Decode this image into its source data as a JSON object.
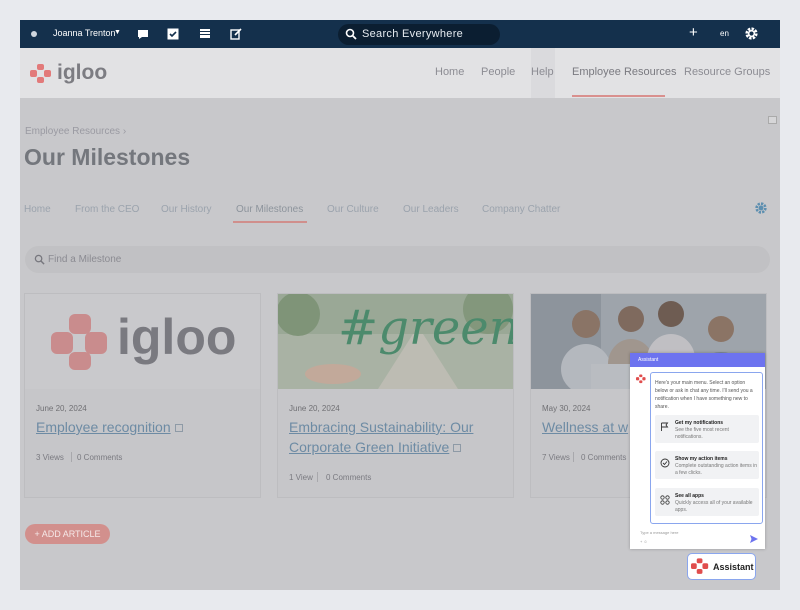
{
  "topbar": {
    "user_name": "Joanna Trenton",
    "search_placeholder": "Search Everywhere",
    "plus": "+",
    "language": "en"
  },
  "site": {
    "logo_text": "igloo",
    "nav": [
      "Home",
      "People",
      "Help",
      "Employee Resources",
      "Resource Groups"
    ],
    "active_nav": "Employee Resources"
  },
  "page": {
    "breadcrumb": "Employee Resources ›",
    "title": "Our Milestones",
    "subnav": [
      "Home",
      "From the CEO",
      "Our History",
      "Our Milestones",
      "Our Culture",
      "Our Leaders",
      "Company Chatter"
    ],
    "active_subnav": "Our Milestones",
    "search_placeholder": "Find a Milestone",
    "add_article": "+ ADD ARTICLE"
  },
  "cards": [
    {
      "date": "June 20, 2024",
      "title": "Employee recognition",
      "views": "3 Views",
      "comments": "0 Comments",
      "image": "igloo logo",
      "image_text": "igloo"
    },
    {
      "date": "June 20, 2024",
      "title": "Embracing Sustainability: Our Corporate Green Initiative",
      "views": "1 View",
      "comments": "0 Comments",
      "image": "#green hand photo",
      "image_text": "#green"
    },
    {
      "date": "May 30, 2024",
      "title": "Wellness at w",
      "views": "7 Views",
      "comments": "0 Comments",
      "image": "team photo"
    }
  ],
  "assistant": {
    "header": "Assistant",
    "intro": "Here's your main menu. Select an option below or ask in chat any time. I'll send you a notification when I have something new to share.",
    "options": [
      {
        "title": "Get my notifications",
        "desc": "See the five most recent notifications.",
        "icon": "flag-icon"
      },
      {
        "title": "Show my action items",
        "desc": "Complete outstanding action items in a few clicks.",
        "icon": "check-circle-icon"
      },
      {
        "title": "See all apps",
        "desc": "Quickly access all of your available apps.",
        "icon": "apps-icon"
      }
    ],
    "input_placeholder": "Type a message here",
    "launcher_label": "Assistant"
  },
  "colors": {
    "topbar": "#14304c",
    "accent": "#d9908e",
    "assistant_blue": "#6d73ef"
  }
}
